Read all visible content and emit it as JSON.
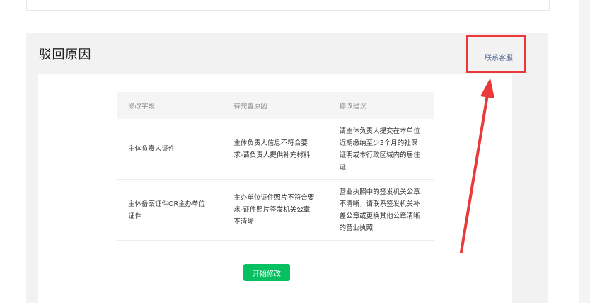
{
  "section": {
    "title": "驳回原因",
    "contact_link": "联系客服"
  },
  "table": {
    "headers": [
      "修改字段",
      "待完善原因",
      "修改建议"
    ],
    "rows": [
      {
        "field": "主体负责人证件",
        "reason": "主体负责人信息不符合要求-请负责人提供补充材料",
        "suggestion": "请主体负责人提交在本单位近期缴纳至少3个月的社保证明或本行政区域内的居住证"
      },
      {
        "field": "主体备案证件OR主办单位证件",
        "reason": "主办单位证件照片不符合要求-证件照片签发机关公章不清晰",
        "suggestion": "营业执照中的签发机关公章不清晰，请联系签发机关补盖公章或更换其他公章清晰的营业执照"
      }
    ]
  },
  "actions": {
    "start_edit_label": "开始修改"
  },
  "colors": {
    "accent_green": "#07c160",
    "annotation_red": "#ea3939",
    "link_blue": "#576b95"
  }
}
